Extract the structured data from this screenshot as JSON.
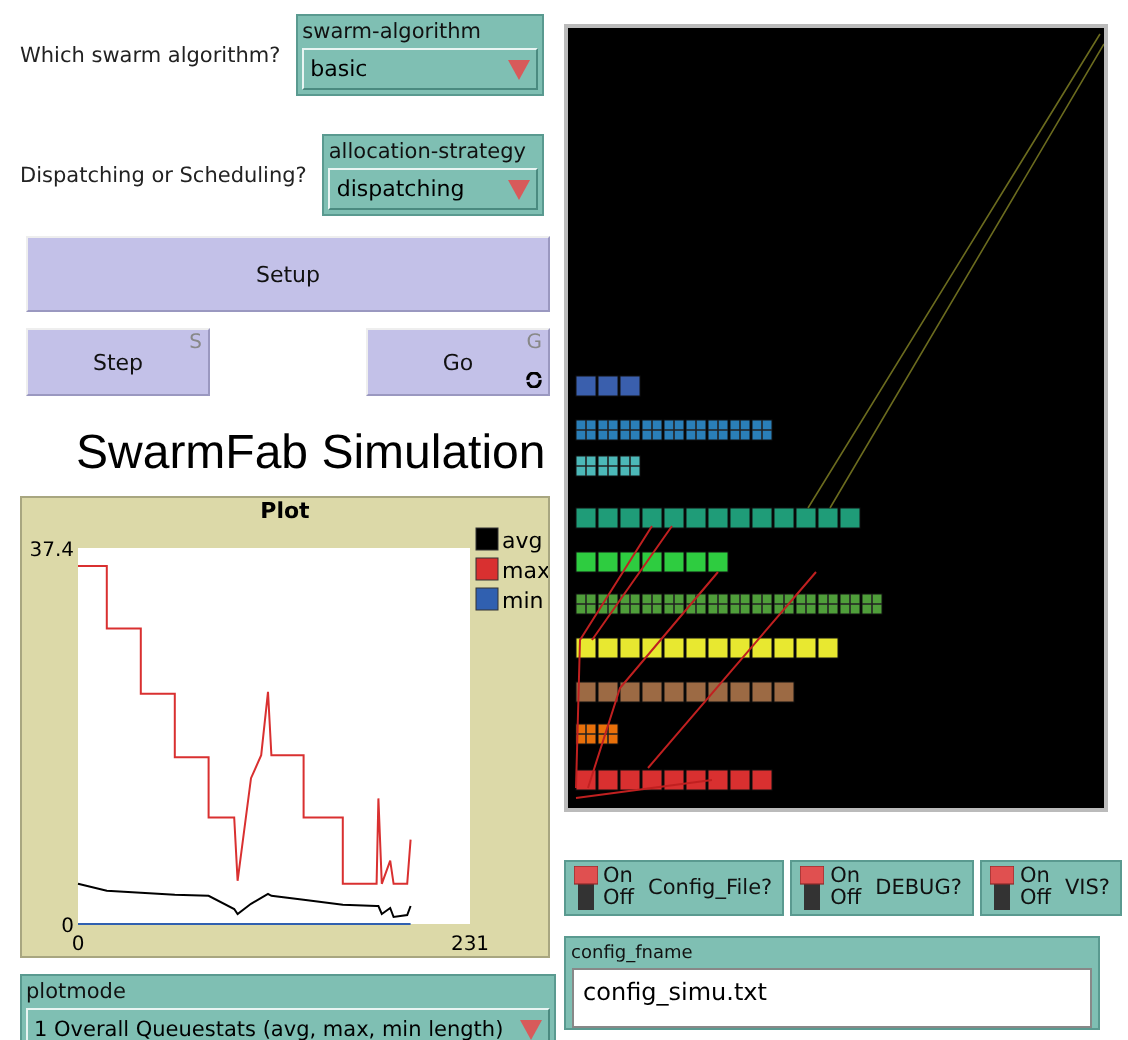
{
  "choosers": [
    {
      "prompt": "Which swarm algorithm?",
      "label": "swarm-algorithm",
      "value": "basic"
    },
    {
      "prompt": "Dispatching or Scheduling?",
      "label": "allocation-strategy",
      "value": "dispatching"
    }
  ],
  "buttons": [
    {
      "label": "Setup",
      "kind": "wide"
    },
    {
      "label": "Step",
      "kind": "once",
      "key": "S"
    },
    {
      "label": "Go",
      "kind": "forever",
      "key": "G"
    }
  ],
  "title": "SwarmFab Simulation",
  "plot": {
    "chart_data": {
      "type": "line",
      "title": "Plot",
      "legend": true,
      "x": [
        0,
        17,
        17,
        37,
        37,
        57,
        57,
        77,
        77,
        92,
        94,
        102,
        108,
        112,
        114,
        133,
        133,
        156,
        156,
        176,
        177,
        179,
        184,
        186,
        194,
        196
      ],
      "xlim": [
        0,
        231
      ],
      "ylim": [
        0,
        37.4
      ],
      "xticks": [
        0,
        231
      ],
      "yticks": [
        0,
        37.4
      ],
      "series": [
        {
          "name": "avg",
          "color": "#000000",
          "values": [
            4.0,
            3.3,
            3.3,
            3.1,
            3.1,
            2.9,
            2.9,
            2.8,
            2.8,
            1.5,
            1.0,
            2.0,
            2.6,
            3.0,
            2.8,
            2.4,
            2.4,
            1.9,
            1.9,
            1.8,
            1.8,
            1.0,
            1.6,
            0.7,
            0.9,
            1.8
          ]
        },
        {
          "name": "max",
          "color": "#d93030",
          "values": [
            35.6,
            35.6,
            29.4,
            29.4,
            22.9,
            22.9,
            16.6,
            16.6,
            10.6,
            10.6,
            4.3,
            14.5,
            16.8,
            23.1,
            16.8,
            16.8,
            10.6,
            10.6,
            4.0,
            4.0,
            12.5,
            4.0,
            6.3,
            4.0,
            4.0,
            8.4
          ]
        },
        {
          "name": "min",
          "color": "#3060b0",
          "values": [
            0,
            0,
            0,
            0,
            0,
            0,
            0,
            0,
            0,
            0,
            0,
            0,
            0,
            0,
            0,
            0,
            0,
            0,
            0,
            0,
            0,
            0,
            0,
            0,
            0,
            0
          ]
        }
      ]
    }
  },
  "plotmode": {
    "label": "plotmode",
    "value": "1 Overall Queuestats (avg, max, min length)"
  },
  "switches": [
    {
      "on_label": "On",
      "off_label": "Off",
      "label": "Config_File?",
      "on": true
    },
    {
      "on_label": "On",
      "off_label": "Off",
      "label": "DEBUG?",
      "on": true
    },
    {
      "on_label": "On",
      "off_label": "Off",
      "label": "VIS?",
      "on": true
    }
  ],
  "config_fname": {
    "label": "config_fname",
    "value": "config_simu.txt"
  }
}
